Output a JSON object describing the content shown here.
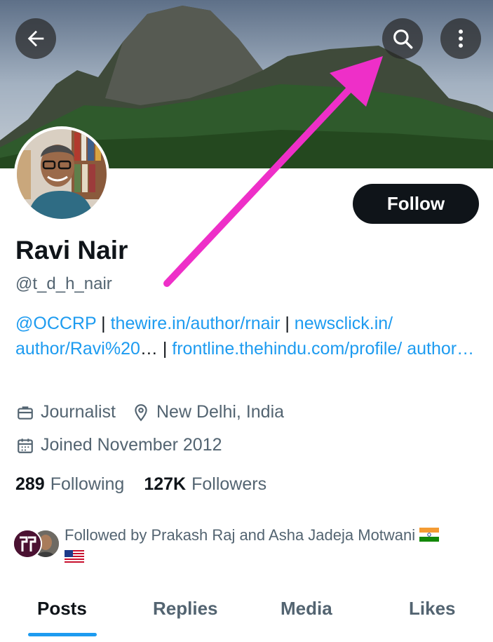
{
  "profile": {
    "name": "Ravi Nair",
    "handle": "@t_d_h_nair",
    "follow_label": "Follow",
    "bio": [
      {
        "text": "@OCCRP",
        "link": true
      },
      {
        "text": " | ",
        "link": false
      },
      {
        "text": "thewire.in/author/rnair",
        "link": true
      },
      {
        "text": " | ",
        "link": false
      },
      {
        "text": "newsclick.in/ author/Ravi%20",
        "link": true
      },
      {
        "text": "… | ",
        "link": false
      },
      {
        "text": "frontline.thehindu.com/profile/ author…",
        "link": true
      }
    ],
    "profession": "Journalist",
    "location": "New Delhi, India",
    "joined": "Joined November 2012",
    "following_count": "289",
    "following_label": "Following",
    "followers_count": "127K",
    "followers_label": "Followers",
    "followed_by": "Followed by Prakash Raj and Asha Jadeja Motwani"
  },
  "tabs": [
    {
      "label": "Posts",
      "active": true
    },
    {
      "label": "Replies",
      "active": false
    },
    {
      "label": "Media",
      "active": false
    },
    {
      "label": "Likes",
      "active": false
    }
  ],
  "icons": {
    "back": "arrow-left-icon",
    "search": "search-icon",
    "more": "more-vertical-icon",
    "briefcase": "briefcase-icon",
    "location": "location-pin-icon",
    "calendar": "calendar-icon"
  },
  "colors": {
    "accent": "#1d9bf0",
    "text": "#0f1419",
    "secondary": "#536471",
    "annotation_arrow": "#ee2fc8"
  }
}
